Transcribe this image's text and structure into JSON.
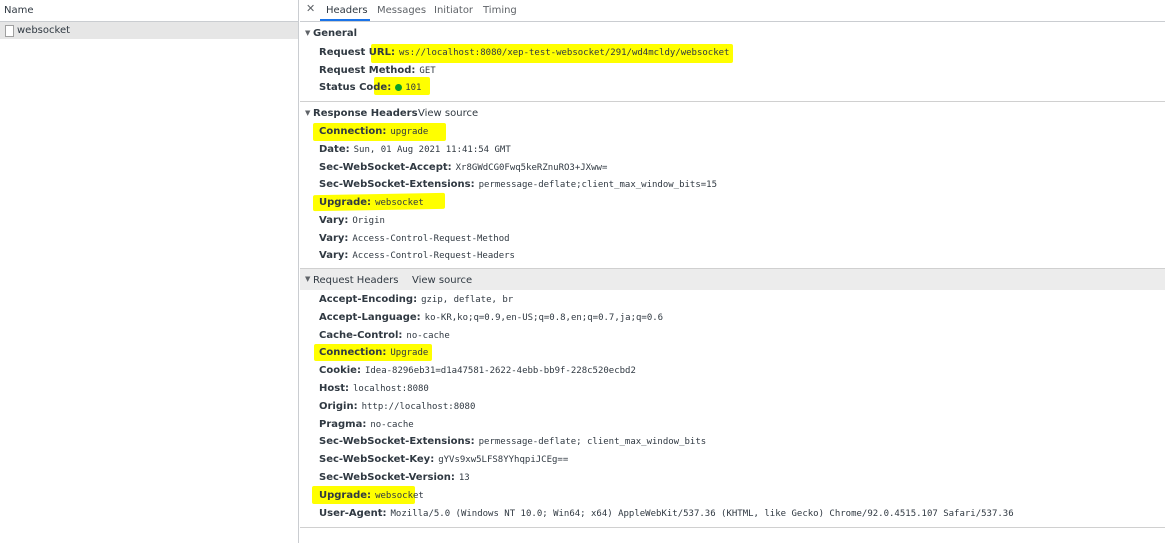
{
  "left_panel": {
    "column_header": "Name",
    "items": [
      {
        "label": "websocket"
      }
    ]
  },
  "tabs": [
    {
      "label": "Headers",
      "active": true
    },
    {
      "label": "Messages"
    },
    {
      "label": "Initiator"
    },
    {
      "label": "Timing"
    }
  ],
  "general": {
    "title": "General",
    "request_url": {
      "key": "Request URL:",
      "value": "ws://localhost:8080/xep-test-websocket/291/wd4mcldy/websocket"
    },
    "request_method": {
      "key": "Request Method:",
      "value": "GET"
    },
    "status_code": {
      "key": "Status Code:",
      "value": "101",
      "status_color": "#0a9e2a"
    }
  },
  "response_headers": {
    "title": "Response Headers",
    "view_source": "View source",
    "rows": [
      {
        "key": "Connection:",
        "value": "upgrade"
      },
      {
        "key": "Date:",
        "value": "Sun, 01 Aug 2021 11:41:54 GMT"
      },
      {
        "key": "Sec-WebSocket-Accept:",
        "value": "Xr8GWdCG0Fwq5keRZnuRO3+JXww="
      },
      {
        "key": "Sec-WebSocket-Extensions:",
        "value": "permessage-deflate;client_max_window_bits=15"
      },
      {
        "key": "Upgrade:",
        "value": "websocket"
      },
      {
        "key": "Vary:",
        "value": "Origin"
      },
      {
        "key": "Vary:",
        "value": "Access-Control-Request-Method"
      },
      {
        "key": "Vary:",
        "value": "Access-Control-Request-Headers"
      }
    ]
  },
  "request_headers": {
    "title": "Request Headers",
    "view_source": "View source",
    "rows": [
      {
        "key": "Accept-Encoding:",
        "value": "gzip, deflate, br"
      },
      {
        "key": "Accept-Language:",
        "value": "ko-KR,ko;q=0.9,en-US;q=0.8,en;q=0.7,ja;q=0.6"
      },
      {
        "key": "Cache-Control:",
        "value": "no-cache"
      },
      {
        "key": "Connection:",
        "value": "Upgrade"
      },
      {
        "key": "Cookie:",
        "value": "Idea-8296eb31=d1a47581-2622-4ebb-bb9f-228c520ecbd2"
      },
      {
        "key": "Host:",
        "value": "localhost:8080"
      },
      {
        "key": "Origin:",
        "value": "http://localhost:8080"
      },
      {
        "key": "Pragma:",
        "value": "no-cache"
      },
      {
        "key": "Sec-WebSocket-Extensions:",
        "value": "permessage-deflate; client_max_window_bits"
      },
      {
        "key": "Sec-WebSocket-Key:",
        "value": "gYVs9xw5LFS8YYhqpiJCEg=="
      },
      {
        "key": "Sec-WebSocket-Version:",
        "value": "13"
      },
      {
        "key": "Upgrade:",
        "value": "websocket"
      },
      {
        "key": "User-Agent:",
        "value": "Mozilla/5.0 (Windows NT 10.0; Win64; x64) AppleWebKit/537.36 (KHTML, like Gecko) Chrome/92.0.4515.107 Safari/537.36"
      }
    ]
  },
  "highlight_color": "#ffff00"
}
